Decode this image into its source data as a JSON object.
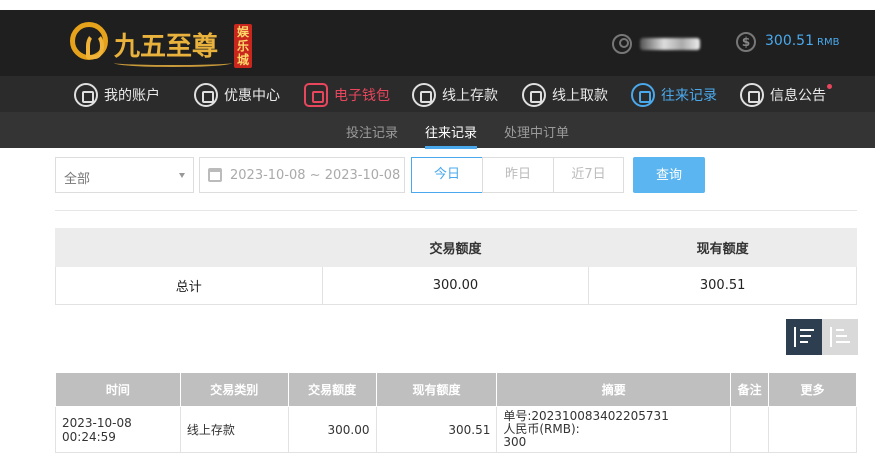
{
  "header": {
    "logo_text": "九五至尊",
    "logo_badge": "娱乐城",
    "balance": "300.51",
    "currency": "RMB"
  },
  "main_nav": [
    {
      "label": "我的账户",
      "icon": "user-icon"
    },
    {
      "label": "优惠中心",
      "icon": "gift-icon"
    },
    {
      "label": "电子钱包",
      "icon": "wallet-icon"
    },
    {
      "label": "线上存款",
      "icon": "deposit-icon"
    },
    {
      "label": "线上取款",
      "icon": "withdraw-icon"
    },
    {
      "label": "往来记录",
      "icon": "record-icon"
    },
    {
      "label": "信息公告",
      "icon": "bell-icon"
    }
  ],
  "sub_nav": [
    {
      "label": "投注记录"
    },
    {
      "label": "往来记录"
    },
    {
      "label": "处理中订单"
    }
  ],
  "filters": {
    "type_select": "全部",
    "date_range": "2023-10-08 ~ 2023-10-08",
    "quick": [
      "今日",
      "昨日",
      "近7日"
    ],
    "search_label": "查询"
  },
  "summary": {
    "headers": [
      "",
      "交易额度",
      "现有额度"
    ],
    "row": [
      "总计",
      "300.00",
      "300.51"
    ]
  },
  "records": {
    "headers": [
      "时间",
      "交易类别",
      "交易额度",
      "现有额度",
      "摘要",
      "备注",
      "更多"
    ],
    "rows": [
      {
        "time": "2023-10-08 00:24:59",
        "type": "线上存款",
        "amount": "300.00",
        "balance": "300.51",
        "memo_line1": "单号:202310083402205731",
        "memo_line2": "人民币(RMB):",
        "memo_line3": "300",
        "remark": "",
        "more": ""
      }
    ]
  },
  "colors": {
    "accent": "#4aa9ec",
    "alert": "#e8465c",
    "logo_gold": "#e8b23c"
  }
}
